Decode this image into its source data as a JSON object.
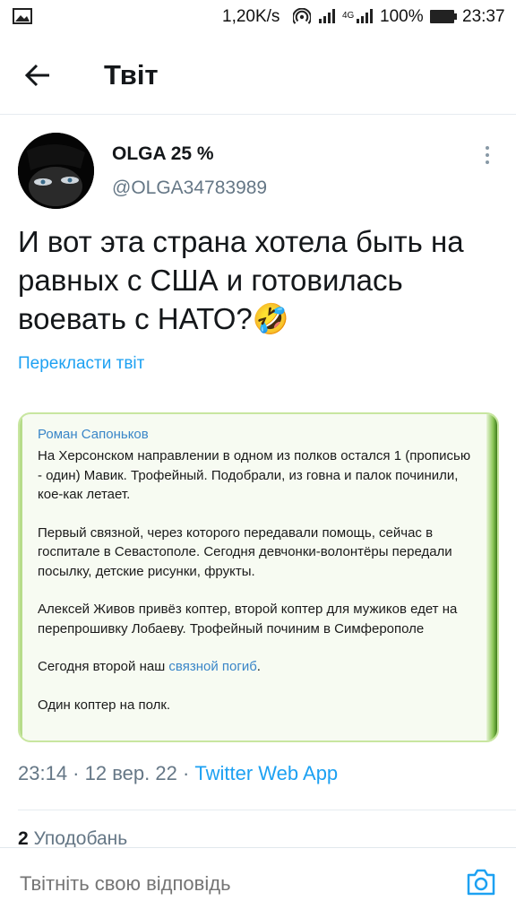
{
  "status_bar": {
    "speed": "1,20K/s",
    "network_label": "4G",
    "battery_percent": "100%",
    "time": "23:37"
  },
  "header": {
    "title": "Твіт"
  },
  "tweet": {
    "author_name": "OLGA 25 %",
    "author_handle": "@OLGA34783989",
    "text": "И вот эта страна хотела быть на равных с США и готовилась воевать с НАТО?🤣",
    "translate_label": "Перекласти твіт",
    "image": {
      "author": "Роман Сапоньков",
      "paragraphs": [
        "На Херсонском направлении в одном из полков остался 1 (прописью - один) Мавик. Трофейный. Подобрали,  из говна и палок починили, кое-как летает.",
        "Первый связной, через которого передавали помощь, сейчас в госпитале в Севастополе. Сегодня девчонки-волонтёры передали посылку,  детские рисунки, фрукты.",
        "Алексей Живов привёз коптер, второй коптер для мужиков едет на перепрошивку Лобаеву.  Трофейный починим в Симферополе"
      ],
      "today_prefix": "Сегодня  второй наш ",
      "today_link": "связной погиб",
      "today_suffix": ".",
      "last_line": "Один коптер на полк."
    },
    "time": "23:14",
    "date": "12 вер. 22",
    "source": "Twitter Web App",
    "likes_count": "2",
    "likes_label": "Уподобань"
  },
  "reply": {
    "placeholder": "Твітніть свою відповідь"
  },
  "colors": {
    "accent": "#1da1f2",
    "secondary_text": "#657786"
  },
  "icons": [
    "image-icon",
    "hotspot-icon",
    "signal-icon",
    "battery-icon",
    "back-arrow-icon",
    "more-vertical-icon",
    "camera-icon"
  ]
}
